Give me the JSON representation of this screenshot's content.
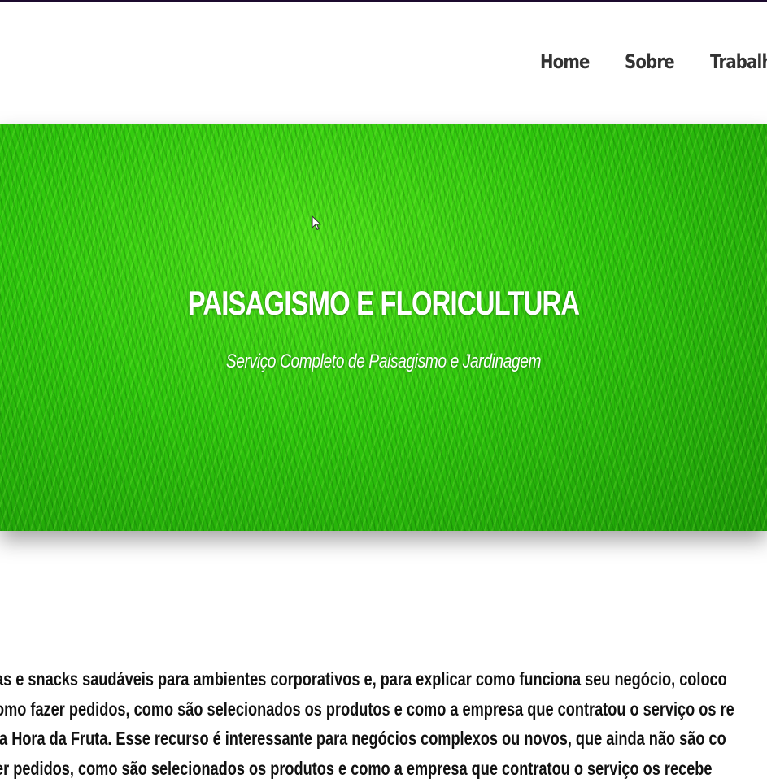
{
  "nav": {
    "items": [
      {
        "label": "Home"
      },
      {
        "label": "Sobre"
      },
      {
        "label": "Trabalh"
      }
    ]
  },
  "hero": {
    "title": "PAISAGISMO E FLORICULTURA",
    "subtitle": "Serviço Completo de Paisagismo e Jardinagem"
  },
  "content": {
    "lines": [
      "as e snacks saudáveis para ambientes corporativos e, para explicar como funciona seu negócio, coloco",
      "omo fazer pedidos, como são selecionados os produtos e como a empresa que contratou o serviço os re",
      "la Hora da Fruta. Esse recurso é interessante para negócios complexos ou novos, que ainda não são co",
      "er pedidos, como são selecionados os produtos e como a empresa que contratou o serviço os recebe"
    ]
  }
}
